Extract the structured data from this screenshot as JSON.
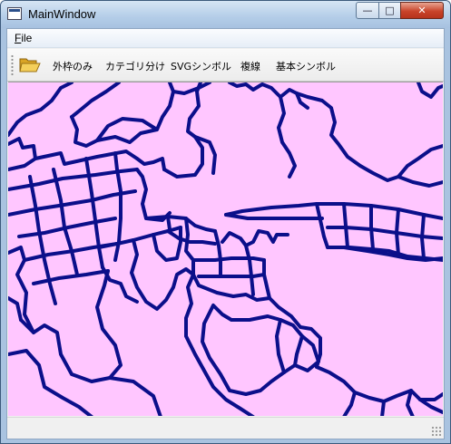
{
  "window": {
    "title": "MainWindow",
    "controls": {
      "minimize": "—",
      "maximize": "□",
      "close": "✕"
    }
  },
  "menubar": {
    "file_label": "File",
    "file_mnemonic": "F",
    "file_rest": "ile"
  },
  "toolbar": {
    "open_icon": "folder-open-icon",
    "buttons": [
      "外枠のみ",
      "カテゴリ分け",
      "SVGシンボル",
      "複線",
      "基本シンボル"
    ]
  },
  "map": {
    "fill_color": "#ffc6ff",
    "line_color": "#0b0f8a"
  }
}
